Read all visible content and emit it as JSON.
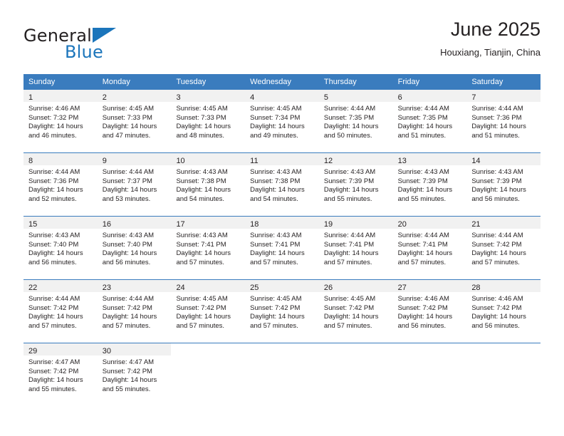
{
  "brand": {
    "name_part1": "General",
    "name_part2": "Blue",
    "logo_icon": "triangle-logo-icon"
  },
  "header": {
    "title": "June 2025",
    "location": "Houxiang, Tianjin, China"
  },
  "calendar": {
    "weekday_headers": [
      "Sunday",
      "Monday",
      "Tuesday",
      "Wednesday",
      "Thursday",
      "Friday",
      "Saturday"
    ],
    "colors": {
      "header_blue": "#3a7cbe",
      "daynum_band": "#f1f1f1",
      "brand_blue": "#1b75bb",
      "text": "#231f20"
    },
    "weeks": [
      [
        {
          "day": "1",
          "sunrise": "Sunrise: 4:46 AM",
          "sunset": "Sunset: 7:32 PM",
          "daylight1": "Daylight: 14 hours",
          "daylight2": "and 46 minutes."
        },
        {
          "day": "2",
          "sunrise": "Sunrise: 4:45 AM",
          "sunset": "Sunset: 7:33 PM",
          "daylight1": "Daylight: 14 hours",
          "daylight2": "and 47 minutes."
        },
        {
          "day": "3",
          "sunrise": "Sunrise: 4:45 AM",
          "sunset": "Sunset: 7:33 PM",
          "daylight1": "Daylight: 14 hours",
          "daylight2": "and 48 minutes."
        },
        {
          "day": "4",
          "sunrise": "Sunrise: 4:45 AM",
          "sunset": "Sunset: 7:34 PM",
          "daylight1": "Daylight: 14 hours",
          "daylight2": "and 49 minutes."
        },
        {
          "day": "5",
          "sunrise": "Sunrise: 4:44 AM",
          "sunset": "Sunset: 7:35 PM",
          "daylight1": "Daylight: 14 hours",
          "daylight2": "and 50 minutes."
        },
        {
          "day": "6",
          "sunrise": "Sunrise: 4:44 AM",
          "sunset": "Sunset: 7:35 PM",
          "daylight1": "Daylight: 14 hours",
          "daylight2": "and 51 minutes."
        },
        {
          "day": "7",
          "sunrise": "Sunrise: 4:44 AM",
          "sunset": "Sunset: 7:36 PM",
          "daylight1": "Daylight: 14 hours",
          "daylight2": "and 51 minutes."
        }
      ],
      [
        {
          "day": "8",
          "sunrise": "Sunrise: 4:44 AM",
          "sunset": "Sunset: 7:36 PM",
          "daylight1": "Daylight: 14 hours",
          "daylight2": "and 52 minutes."
        },
        {
          "day": "9",
          "sunrise": "Sunrise: 4:44 AM",
          "sunset": "Sunset: 7:37 PM",
          "daylight1": "Daylight: 14 hours",
          "daylight2": "and 53 minutes."
        },
        {
          "day": "10",
          "sunrise": "Sunrise: 4:43 AM",
          "sunset": "Sunset: 7:38 PM",
          "daylight1": "Daylight: 14 hours",
          "daylight2": "and 54 minutes."
        },
        {
          "day": "11",
          "sunrise": "Sunrise: 4:43 AM",
          "sunset": "Sunset: 7:38 PM",
          "daylight1": "Daylight: 14 hours",
          "daylight2": "and 54 minutes."
        },
        {
          "day": "12",
          "sunrise": "Sunrise: 4:43 AM",
          "sunset": "Sunset: 7:39 PM",
          "daylight1": "Daylight: 14 hours",
          "daylight2": "and 55 minutes."
        },
        {
          "day": "13",
          "sunrise": "Sunrise: 4:43 AM",
          "sunset": "Sunset: 7:39 PM",
          "daylight1": "Daylight: 14 hours",
          "daylight2": "and 55 minutes."
        },
        {
          "day": "14",
          "sunrise": "Sunrise: 4:43 AM",
          "sunset": "Sunset: 7:39 PM",
          "daylight1": "Daylight: 14 hours",
          "daylight2": "and 56 minutes."
        }
      ],
      [
        {
          "day": "15",
          "sunrise": "Sunrise: 4:43 AM",
          "sunset": "Sunset: 7:40 PM",
          "daylight1": "Daylight: 14 hours",
          "daylight2": "and 56 minutes."
        },
        {
          "day": "16",
          "sunrise": "Sunrise: 4:43 AM",
          "sunset": "Sunset: 7:40 PM",
          "daylight1": "Daylight: 14 hours",
          "daylight2": "and 56 minutes."
        },
        {
          "day": "17",
          "sunrise": "Sunrise: 4:43 AM",
          "sunset": "Sunset: 7:41 PM",
          "daylight1": "Daylight: 14 hours",
          "daylight2": "and 57 minutes."
        },
        {
          "day": "18",
          "sunrise": "Sunrise: 4:43 AM",
          "sunset": "Sunset: 7:41 PM",
          "daylight1": "Daylight: 14 hours",
          "daylight2": "and 57 minutes."
        },
        {
          "day": "19",
          "sunrise": "Sunrise: 4:44 AM",
          "sunset": "Sunset: 7:41 PM",
          "daylight1": "Daylight: 14 hours",
          "daylight2": "and 57 minutes."
        },
        {
          "day": "20",
          "sunrise": "Sunrise: 4:44 AM",
          "sunset": "Sunset: 7:41 PM",
          "daylight1": "Daylight: 14 hours",
          "daylight2": "and 57 minutes."
        },
        {
          "day": "21",
          "sunrise": "Sunrise: 4:44 AM",
          "sunset": "Sunset: 7:42 PM",
          "daylight1": "Daylight: 14 hours",
          "daylight2": "and 57 minutes."
        }
      ],
      [
        {
          "day": "22",
          "sunrise": "Sunrise: 4:44 AM",
          "sunset": "Sunset: 7:42 PM",
          "daylight1": "Daylight: 14 hours",
          "daylight2": "and 57 minutes."
        },
        {
          "day": "23",
          "sunrise": "Sunrise: 4:44 AM",
          "sunset": "Sunset: 7:42 PM",
          "daylight1": "Daylight: 14 hours",
          "daylight2": "and 57 minutes."
        },
        {
          "day": "24",
          "sunrise": "Sunrise: 4:45 AM",
          "sunset": "Sunset: 7:42 PM",
          "daylight1": "Daylight: 14 hours",
          "daylight2": "and 57 minutes."
        },
        {
          "day": "25",
          "sunrise": "Sunrise: 4:45 AM",
          "sunset": "Sunset: 7:42 PM",
          "daylight1": "Daylight: 14 hours",
          "daylight2": "and 57 minutes."
        },
        {
          "day": "26",
          "sunrise": "Sunrise: 4:45 AM",
          "sunset": "Sunset: 7:42 PM",
          "daylight1": "Daylight: 14 hours",
          "daylight2": "and 57 minutes."
        },
        {
          "day": "27",
          "sunrise": "Sunrise: 4:46 AM",
          "sunset": "Sunset: 7:42 PM",
          "daylight1": "Daylight: 14 hours",
          "daylight2": "and 56 minutes."
        },
        {
          "day": "28",
          "sunrise": "Sunrise: 4:46 AM",
          "sunset": "Sunset: 7:42 PM",
          "daylight1": "Daylight: 14 hours",
          "daylight2": "and 56 minutes."
        }
      ],
      [
        {
          "day": "29",
          "sunrise": "Sunrise: 4:47 AM",
          "sunset": "Sunset: 7:42 PM",
          "daylight1": "Daylight: 14 hours",
          "daylight2": "and 55 minutes."
        },
        {
          "day": "30",
          "sunrise": "Sunrise: 4:47 AM",
          "sunset": "Sunset: 7:42 PM",
          "daylight1": "Daylight: 14 hours",
          "daylight2": "and 55 minutes."
        },
        {
          "day": "",
          "sunrise": "",
          "sunset": "",
          "daylight1": "",
          "daylight2": ""
        },
        {
          "day": "",
          "sunrise": "",
          "sunset": "",
          "daylight1": "",
          "daylight2": ""
        },
        {
          "day": "",
          "sunrise": "",
          "sunset": "",
          "daylight1": "",
          "daylight2": ""
        },
        {
          "day": "",
          "sunrise": "",
          "sunset": "",
          "daylight1": "",
          "daylight2": ""
        },
        {
          "day": "",
          "sunrise": "",
          "sunset": "",
          "daylight1": "",
          "daylight2": ""
        }
      ]
    ]
  }
}
